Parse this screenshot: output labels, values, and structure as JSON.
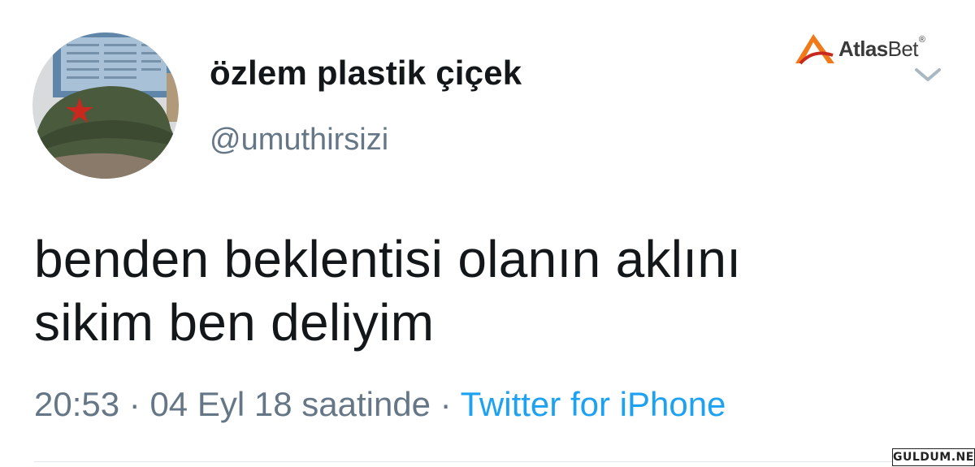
{
  "user": {
    "display_name": "özlem plastik çiçek",
    "handle": "@umuthirsizi",
    "avatar": "profile-photo-green-cap-red-star"
  },
  "tweet": {
    "lines": [
      "benden beklentisi olanın aklını",
      "sikim ben deliyim"
    ]
  },
  "meta": {
    "time": "20:53",
    "separator": " · ",
    "date": "04 Eyl 18 saatinde",
    "source": "Twitter for iPhone"
  },
  "brand": {
    "name_bold": "Atlas",
    "name_light": "Bet",
    "reg": "®"
  },
  "menu_icon": "chevron-down-icon",
  "watermark": "GULDUM.NET",
  "colors": {
    "text": "#14171a",
    "secondary": "#657786",
    "link": "#1da1f2",
    "brand_orange": "#f07a1a"
  }
}
